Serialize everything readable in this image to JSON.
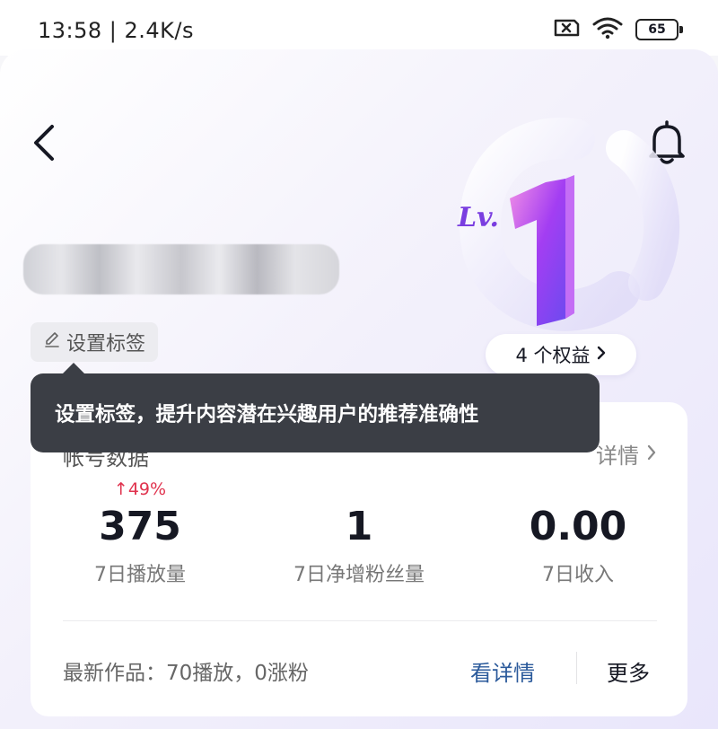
{
  "status_bar": {
    "time": "13:58 | 2.4K/s",
    "battery": "65"
  },
  "profile": {
    "level_label": "Lv.",
    "level_number": "1",
    "tag_label": "设置标签",
    "perks_label": "4 个权益"
  },
  "tooltip": {
    "text": "设置标签，提升内容潜在兴趣用户的推荐准确性"
  },
  "account_card": {
    "title": "帐号数据",
    "detail_label": "详情",
    "stats": [
      {
        "delta": "↑49%",
        "value": "375",
        "label": "7日播放量"
      },
      {
        "delta": "",
        "value": "1",
        "label": "7日净增粉丝量"
      },
      {
        "delta": "",
        "value": "0.00",
        "label": "7日收入"
      }
    ],
    "latest_work": "最新作品：70播放，0涨粉",
    "see_detail_label": "看详情",
    "more_label": "更多"
  },
  "colors": {
    "accent_purple": "#a23cf0",
    "delta_red": "#e0334e",
    "link_blue": "#2b5a9b"
  }
}
